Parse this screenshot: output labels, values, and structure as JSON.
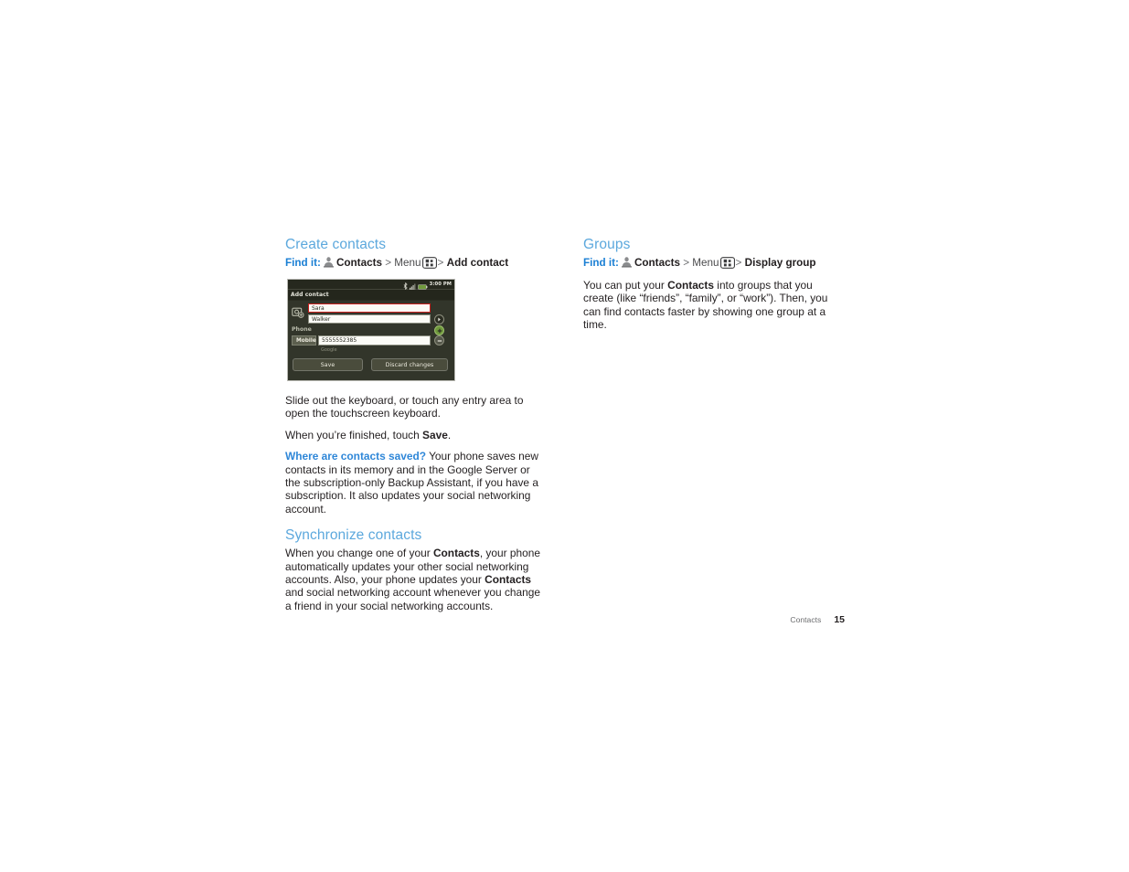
{
  "document": {
    "footer": {
      "chapter": "Contacts",
      "page_number": "15"
    }
  },
  "colors": {
    "heading_blue": "#5ca8dd",
    "findit_blue": "#1a7fd4",
    "tip_blue": "#2f87d8",
    "body_text": "#231f20",
    "focus_red": "#c8201e",
    "plus_green": "#7ab83a"
  },
  "left_column": {
    "section1": {
      "heading": "Create contacts",
      "findit": {
        "label": "Find it:",
        "app": "Contacts",
        "sep1": ">",
        "menu": "Menu",
        "sep2": ">",
        "target": "Add contact",
        "person_icon": "person-icon",
        "menu_icon": "menu-key-icon"
      },
      "screenshot": {
        "status_time": "3:00 PM",
        "status_icons": [
          "bluetooth-icon",
          "signal-bars-icon",
          "battery-icon"
        ],
        "title": "Add contact",
        "avatar_icon": "contact-photo-icon",
        "first_name": "Sara",
        "last_name": "Walker",
        "expand_icon": "arrow-right-icon",
        "phone_label": "Phone",
        "add_icon": "plus-icon",
        "phone_type": "Mobile",
        "phone_number": "5555552385",
        "remove_icon": "minus-icon",
        "account": "Google",
        "save_button": "Save",
        "discard_button": "Discard changes"
      },
      "paragraphs": [
        {
          "runs": [
            {
              "text": "Slide out the keyboard, or touch any entry area to open the touchscreen keyboard.",
              "style": "normal"
            }
          ]
        },
        {
          "runs": [
            {
              "text": "When you’re finished, touch ",
              "style": "normal"
            },
            {
              "text": "Save",
              "style": "bold"
            },
            {
              "text": ".",
              "style": "normal"
            }
          ]
        },
        {
          "runs": [
            {
              "text": "Where are contacts saved?",
              "style": "tip"
            },
            {
              "text": " Your phone saves new contacts in its memory and in the Google Server or the subscription-only Backup Assistant, if you have a subscription. It also updates your social networking account.",
              "style": "normal"
            }
          ]
        }
      ]
    },
    "section2": {
      "heading": "Synchronize contacts",
      "paragraphs": [
        {
          "runs": [
            {
              "text": "When you change one of your ",
              "style": "normal"
            },
            {
              "text": "Contacts",
              "style": "bold"
            },
            {
              "text": ", your phone automatically updates your other social networking accounts. Also, your phone updates your ",
              "style": "normal"
            },
            {
              "text": "Contacts",
              "style": "bold"
            },
            {
              "text": " and social networking account whenever you change a friend in your social networking accounts.",
              "style": "normal"
            }
          ]
        }
      ]
    }
  },
  "right_column": {
    "section1": {
      "heading": "Groups",
      "findit": {
        "label": "Find it:",
        "app": "Contacts",
        "sep1": ">",
        "menu": "Menu",
        "sep2": ">",
        "target": "Display group",
        "person_icon": "person-icon",
        "menu_icon": "menu-key-icon"
      },
      "paragraphs": [
        {
          "runs": [
            {
              "text": "You can put your ",
              "style": "normal"
            },
            {
              "text": "Contacts",
              "style": "bold"
            },
            {
              "text": " into groups that you create (like “friends”, “family”, or “work”). Then, you can find contacts faster by showing one group at a time.",
              "style": "normal"
            }
          ]
        }
      ]
    }
  }
}
